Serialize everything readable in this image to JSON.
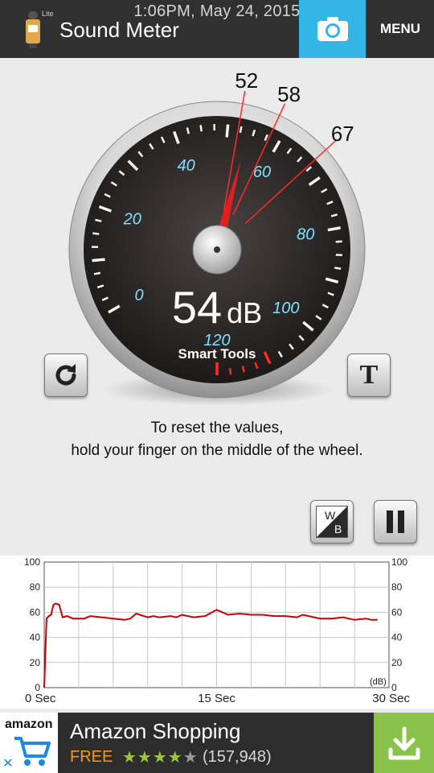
{
  "statusbar": {
    "time_date": "1:06PM, May 24, 2015"
  },
  "actionbar": {
    "badge": "Lite",
    "title": "Sound Meter",
    "camera_icon": "camera-icon",
    "menu_label": "MENU"
  },
  "gauge": {
    "min": 0,
    "max": 120,
    "tick_labels": [
      "0",
      "20",
      "40",
      "60",
      "80",
      "100",
      "120"
    ],
    "current_db": 54,
    "current_value_text": "54",
    "unit": "dB",
    "brand": "Smart Tools",
    "markers": [
      {
        "label": "52",
        "value": 52
      },
      {
        "label": "58",
        "value": 58
      },
      {
        "label": "67",
        "value": 67
      }
    ],
    "accent_color": "#ff2a2a",
    "label_color": "#7fe0ff"
  },
  "buttons": {
    "reset_icon": "refresh-icon",
    "text_icon": "text-icon",
    "text_glyph": "T",
    "wb_icon": "white-black-toggle-icon",
    "wb_top": "W",
    "wb_bottom": "B",
    "pause_icon": "pause-icon"
  },
  "hint": {
    "line1": "To reset the values,",
    "line2": "hold your finger on the middle of the wheel."
  },
  "chart_data": {
    "type": "line",
    "ylim": [
      0,
      100
    ],
    "y_ticks": [
      "100",
      "80",
      "60",
      "40",
      "20",
      "0"
    ],
    "x_ticks": [
      "0 Sec",
      "15 Sec",
      "30 Sec"
    ],
    "unit_label": "(dB)",
    "line_color": "#cc0000",
    "series": [
      {
        "x": [
          0,
          0.2,
          0.4,
          0.6,
          0.8,
          1,
          1.3,
          1.6,
          2,
          2.5,
          3,
          3.5,
          4,
          5,
          6,
          7,
          7.5,
          8,
          9,
          9.5,
          10,
          11,
          11.5,
          12,
          12.5,
          13,
          14,
          15,
          15.5,
          16,
          17,
          18,
          19,
          20,
          21,
          22,
          22.5,
          23,
          24,
          25,
          26,
          27,
          28,
          28.5,
          29
        ],
        "y": [
          0,
          55,
          57,
          58,
          66,
          67,
          66,
          56,
          57,
          55,
          55,
          55,
          57,
          56,
          55,
          54,
          55,
          59,
          56,
          57,
          56,
          57,
          56,
          58,
          57,
          56,
          57,
          62,
          60,
          58,
          59,
          58,
          58,
          57,
          57,
          56,
          58,
          57,
          55,
          55,
          56,
          54,
          55,
          54,
          54
        ]
      }
    ]
  },
  "ad": {
    "logo_text": "amazon",
    "title": "Amazon Shopping",
    "price": "FREE",
    "rating_stars": 4,
    "rating_count": "(157,948)",
    "download_icon": "download-icon",
    "close_icon": "close-icon"
  }
}
